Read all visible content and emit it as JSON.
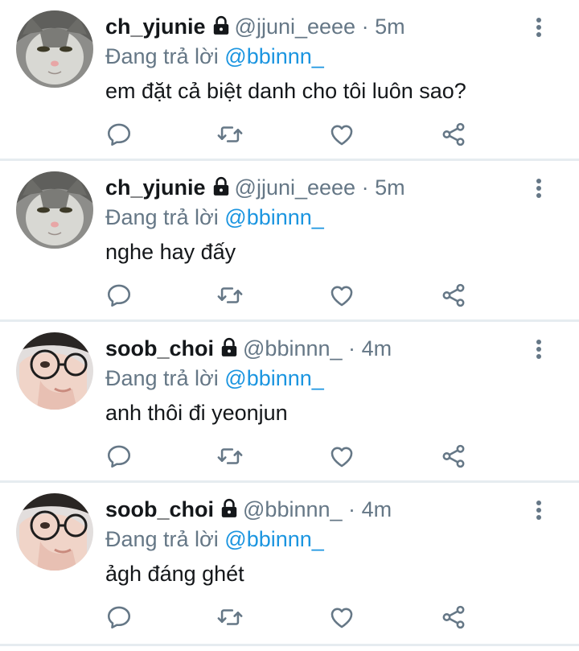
{
  "tweets": [
    {
      "name": "ch_yjunie",
      "handle": "@jjuni_eeee",
      "separator": "·",
      "time": "5m",
      "reply_prefix": "Đang trả lời",
      "reply_to": "@bbinnn_",
      "text": "em đặt cả biệt danh cho tôi luôn sao?",
      "avatar": "cat"
    },
    {
      "name": "ch_yjunie",
      "handle": "@jjuni_eeee",
      "separator": "·",
      "time": "5m",
      "reply_prefix": "Đang trả lời",
      "reply_to": "@bbinnn_",
      "text": "nghe hay đấy",
      "avatar": "cat"
    },
    {
      "name": "soob_choi",
      "handle": "@bbinnn_",
      "separator": "·",
      "time": "4m",
      "reply_prefix": "Đang trả lời",
      "reply_to": "@bbinnn_",
      "text": "anh thôi đi yeonjun",
      "avatar": "person"
    },
    {
      "name": "soob_choi",
      "handle": "@bbinnn_",
      "separator": "·",
      "time": "4m",
      "reply_prefix": "Đang trả lời",
      "reply_to": "@bbinnn_",
      "text": "ảgh đáng ghét",
      "avatar": "person"
    }
  ],
  "icons": [
    "lock-icon",
    "more-vertical-icon",
    "reply-icon",
    "retweet-icon",
    "like-icon",
    "share-icon"
  ],
  "colors": {
    "mention": "#1b95e0",
    "secondary": "#657786",
    "icon": "#657786",
    "divider": "#e6ecf0"
  }
}
